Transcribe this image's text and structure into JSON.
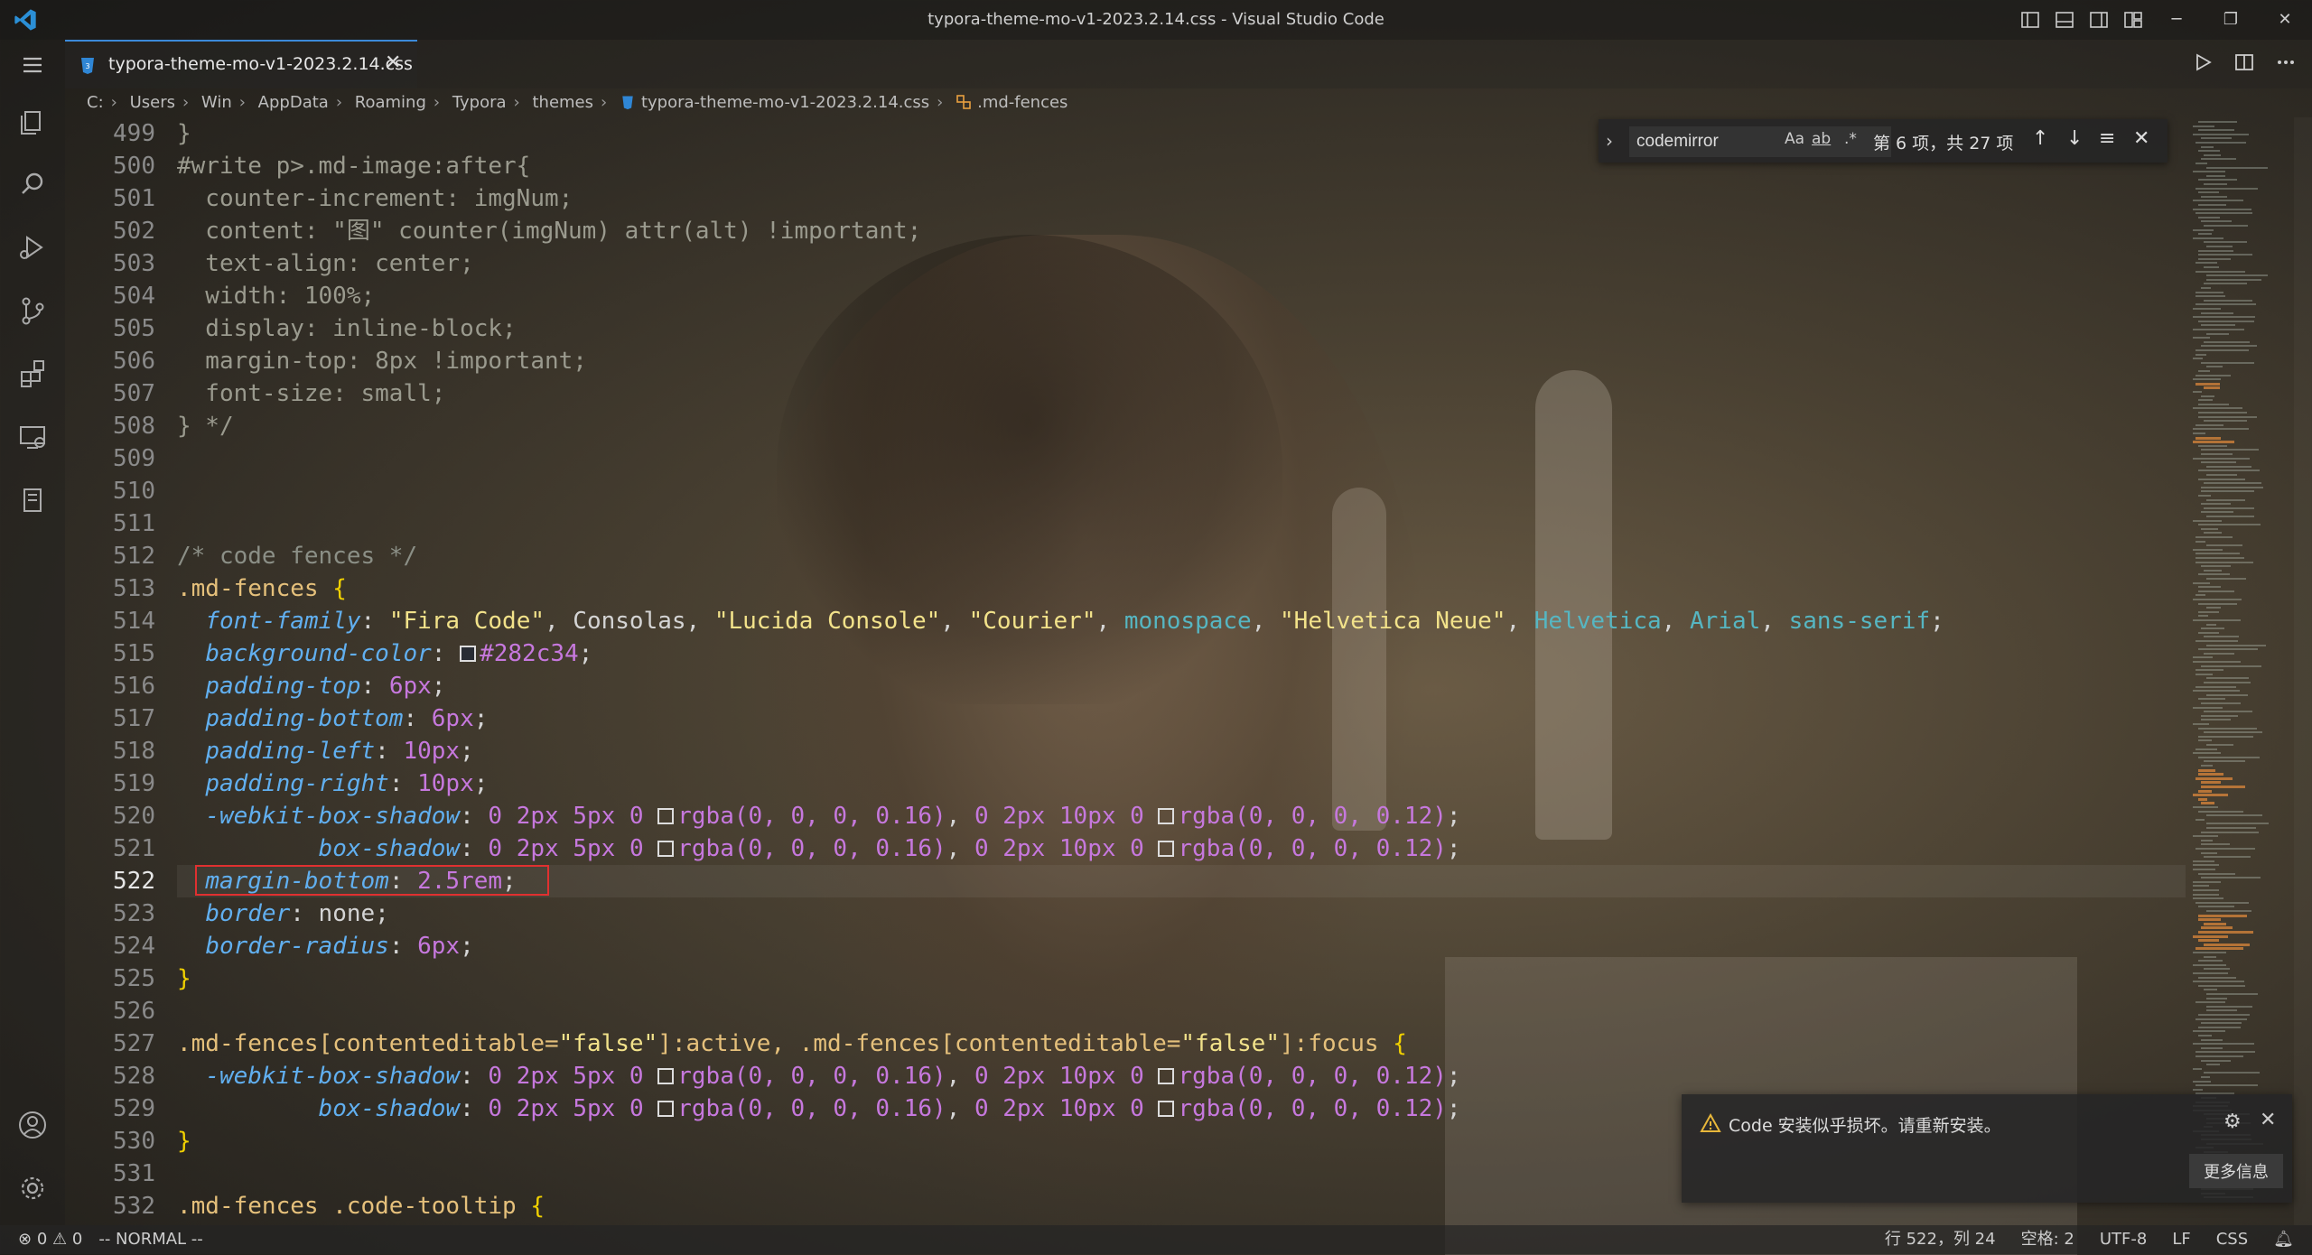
{
  "window": {
    "title": "typora-theme-mo-v1-2023.2.14.css - Visual Studio Code"
  },
  "icons": {
    "app": "vscode-logo-icon",
    "layout": [
      "toggle-primary-sidebar-icon",
      "toggle-panel-icon",
      "toggle-secondary-sidebar-icon",
      "customize-layout-icon"
    ],
    "window_controls": [
      "minimize-icon",
      "restore-icon",
      "close-icon"
    ],
    "activity": [
      "menu-icon",
      "explorer-icon",
      "search-icon",
      "run-debug-icon",
      "source-control-icon",
      "extensions-icon",
      "remote-explorer-icon",
      "notebook-icon",
      "account-icon",
      "settings-gear-icon"
    ]
  },
  "tab": {
    "label": "typora-theme-mo-v1-2023.2.14.css",
    "close_glyph": "✕"
  },
  "breadcrumb": [
    "C:",
    "Users",
    "Win",
    "AppData",
    "Roaming",
    "Typora",
    "themes",
    "typora-theme-mo-v1-2023.2.14.css",
    ".md-fences"
  ],
  "find": {
    "query": "codemirror",
    "match_case": "Aa",
    "whole_word": "ab",
    "regex": ".*",
    "count": "第 6 项，共 27 项"
  },
  "line_numbers": [
    "499",
    "500",
    "501",
    "502",
    "503",
    "504",
    "505",
    "506",
    "507",
    "508",
    "509",
    "510",
    "511",
    "512",
    "513",
    "514",
    "515",
    "516",
    "517",
    "518",
    "519",
    "520",
    "521",
    "522",
    "523",
    "524",
    "525",
    "526",
    "527",
    "528",
    "529",
    "530",
    "531",
    "532"
  ],
  "active_line": "522",
  "notification": {
    "message": "Code 安装似乎损坏。请重新安装。",
    "button": "更多信息"
  },
  "status": {
    "errors": "0",
    "warnings": "0",
    "mode": "-- NORMAL --",
    "position": "行 522，列 24",
    "indent": "空格: 2",
    "encoding": "UTF-8",
    "eol": "LF",
    "language": "CSS"
  },
  "colors": {
    "accent": "#3c8ad9",
    "selector": "#e5c07b",
    "property": "#61afef",
    "string": "#f2e28a",
    "number": "#c678dd",
    "keyword": "#56b6c2",
    "cursor_box": "#e03030"
  }
}
